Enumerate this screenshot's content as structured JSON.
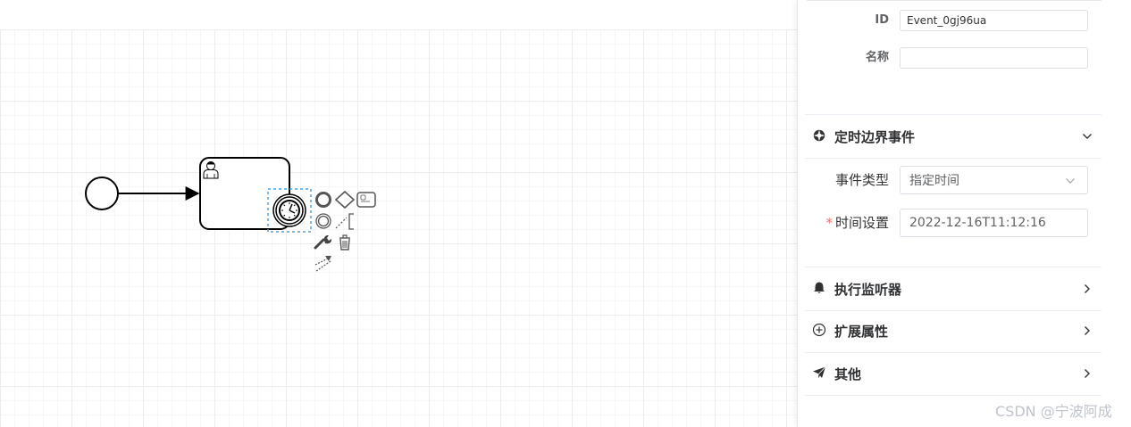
{
  "general": {
    "id_label": "ID",
    "id_value": "Event_0gj96ua",
    "name_label": "名称",
    "name_value": ""
  },
  "timer_section": {
    "title": "定时边界事件",
    "icon": "timer-gear-icon",
    "event_type_label": "事件类型",
    "event_type_value": "指定时间",
    "time_label": "时间设置",
    "time_required_mark": "*",
    "time_value": "2022-12-16T11:12:16"
  },
  "sections": [
    {
      "title": "执行监听器",
      "icon": "bell-icon"
    },
    {
      "title": "扩展属性",
      "icon": "plus-circle-icon"
    },
    {
      "title": "其他",
      "icon": "paper-plane-icon"
    }
  ],
  "watermark": "CSDN @宁波阿成",
  "colors": {
    "selection": "#4ba4d8",
    "required": "#f56c6c",
    "stroke": "#000000",
    "palette_gray": "#666666"
  }
}
